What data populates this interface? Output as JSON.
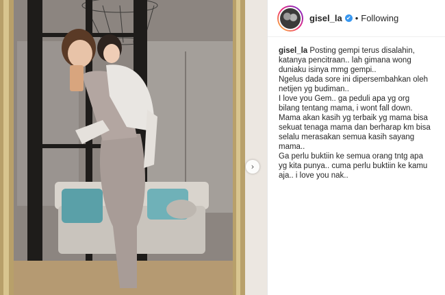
{
  "post": {
    "username": "gisel_la",
    "follow_state": "Following",
    "separator": "•",
    "verified_glyph": "✔"
  },
  "media": {
    "carousel_next_glyph": "›",
    "icons": [
      "carousel-next-icon",
      "verified-icon"
    ]
  },
  "caption": {
    "username": "gisel_la",
    "lines": [
      "Posting gempi terus disalahin,",
      "katanya pencitraan.. lah gimana wong",
      "duniaku isinya mmg gempi..",
      "Ngelus dada sore ini dipersembahkan oleh",
      "netijen yg budiman..",
      "I love you Gem.. ga peduli apa yg org",
      "bilang tentang mama, i wont fall down.",
      "Mama akan kasih yg terbaik yg mama bisa",
      "sekuat tenaga mama dan berharap km bisa",
      "selalu merasakan semua kasih sayang",
      "mama..",
      "Ga perlu buktiin ke semua orang tntg apa",
      "yg kita punya.. cuma perlu buktiin ke kamu",
      "aja.. i love you nak.."
    ]
  },
  "colors": {
    "verified_blue": "#3897f0",
    "text": "#262626",
    "mirror_frame": "#b8a06a"
  }
}
